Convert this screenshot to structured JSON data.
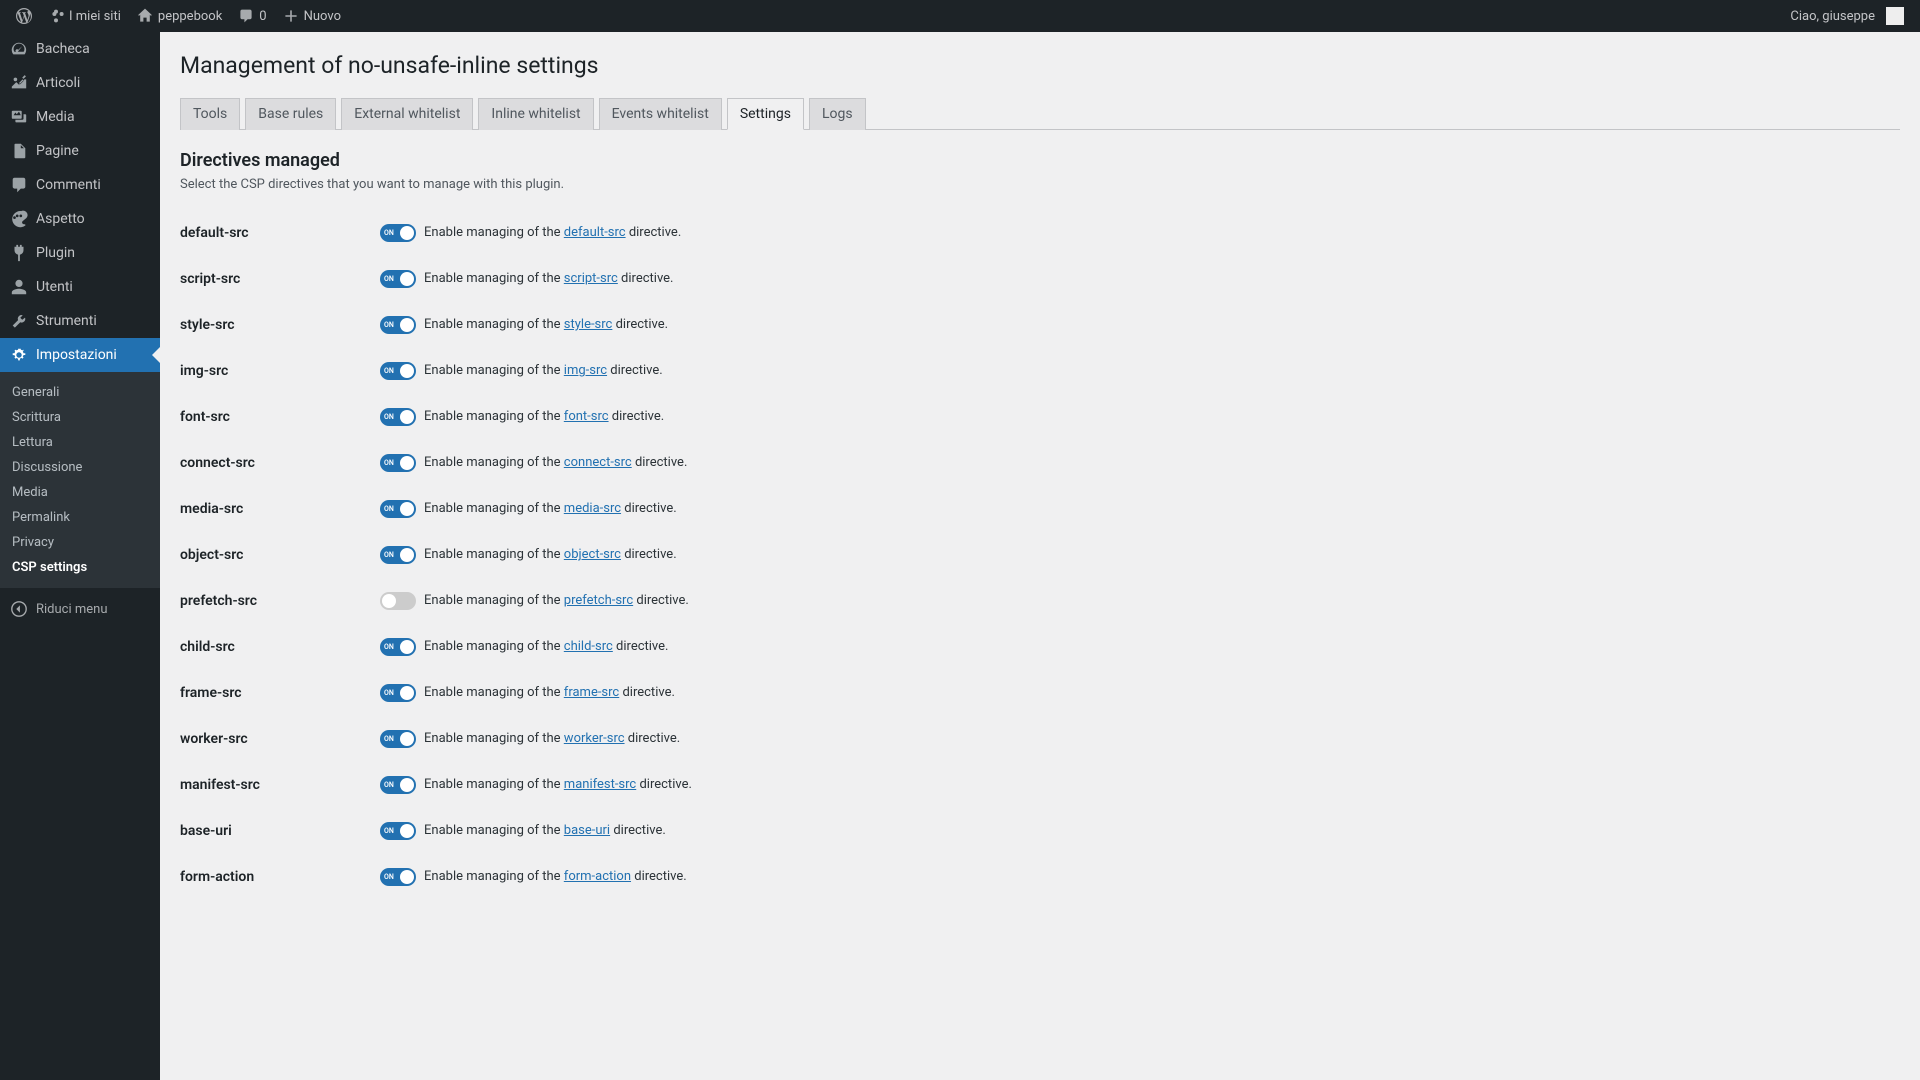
{
  "adminbar": {
    "my_sites": "I miei siti",
    "site_name": "peppebook",
    "comments_count": "0",
    "new_label": "Nuovo",
    "greeting": "Ciao, giuseppe"
  },
  "sidebar": {
    "items": [
      {
        "id": "bacheca",
        "label": "Bacheca"
      },
      {
        "id": "articoli",
        "label": "Articoli"
      },
      {
        "id": "media",
        "label": "Media"
      },
      {
        "id": "pagine",
        "label": "Pagine"
      },
      {
        "id": "commenti",
        "label": "Commenti"
      },
      {
        "id": "aspetto",
        "label": "Aspetto"
      },
      {
        "id": "plugin",
        "label": "Plugin"
      },
      {
        "id": "utenti",
        "label": "Utenti"
      },
      {
        "id": "strumenti",
        "label": "Strumenti"
      },
      {
        "id": "impostazioni",
        "label": "Impostazioni"
      }
    ],
    "submenu": [
      {
        "label": "Generali"
      },
      {
        "label": "Scrittura"
      },
      {
        "label": "Lettura"
      },
      {
        "label": "Discussione"
      },
      {
        "label": "Media"
      },
      {
        "label": "Permalink"
      },
      {
        "label": "Privacy"
      },
      {
        "label": "CSP settings"
      }
    ],
    "collapse": "Riduci menu"
  },
  "page": {
    "title": "Management of no-unsafe-inline settings",
    "tabs": [
      {
        "label": "Tools"
      },
      {
        "label": "Base rules"
      },
      {
        "label": "External whitelist"
      },
      {
        "label": "Inline whitelist"
      },
      {
        "label": "Events whitelist"
      },
      {
        "label": "Settings",
        "active": true
      },
      {
        "label": "Logs"
      }
    ],
    "section_title": "Directives managed",
    "section_desc": "Select the CSP directives that you want to manage with this plugin.",
    "enable_prefix": "Enable managing of the ",
    "directive_suffix": " directive.",
    "toggle_on_label": "ON",
    "directives": [
      {
        "name": "default-src",
        "on": true
      },
      {
        "name": "script-src",
        "on": true
      },
      {
        "name": "style-src",
        "on": true
      },
      {
        "name": "img-src",
        "on": true
      },
      {
        "name": "font-src",
        "on": true
      },
      {
        "name": "connect-src",
        "on": true
      },
      {
        "name": "media-src",
        "on": true
      },
      {
        "name": "object-src",
        "on": true
      },
      {
        "name": "prefetch-src",
        "on": false
      },
      {
        "name": "child-src",
        "on": true
      },
      {
        "name": "frame-src",
        "on": true
      },
      {
        "name": "worker-src",
        "on": true
      },
      {
        "name": "manifest-src",
        "on": true
      },
      {
        "name": "base-uri",
        "on": true
      },
      {
        "name": "form-action",
        "on": true
      }
    ]
  }
}
